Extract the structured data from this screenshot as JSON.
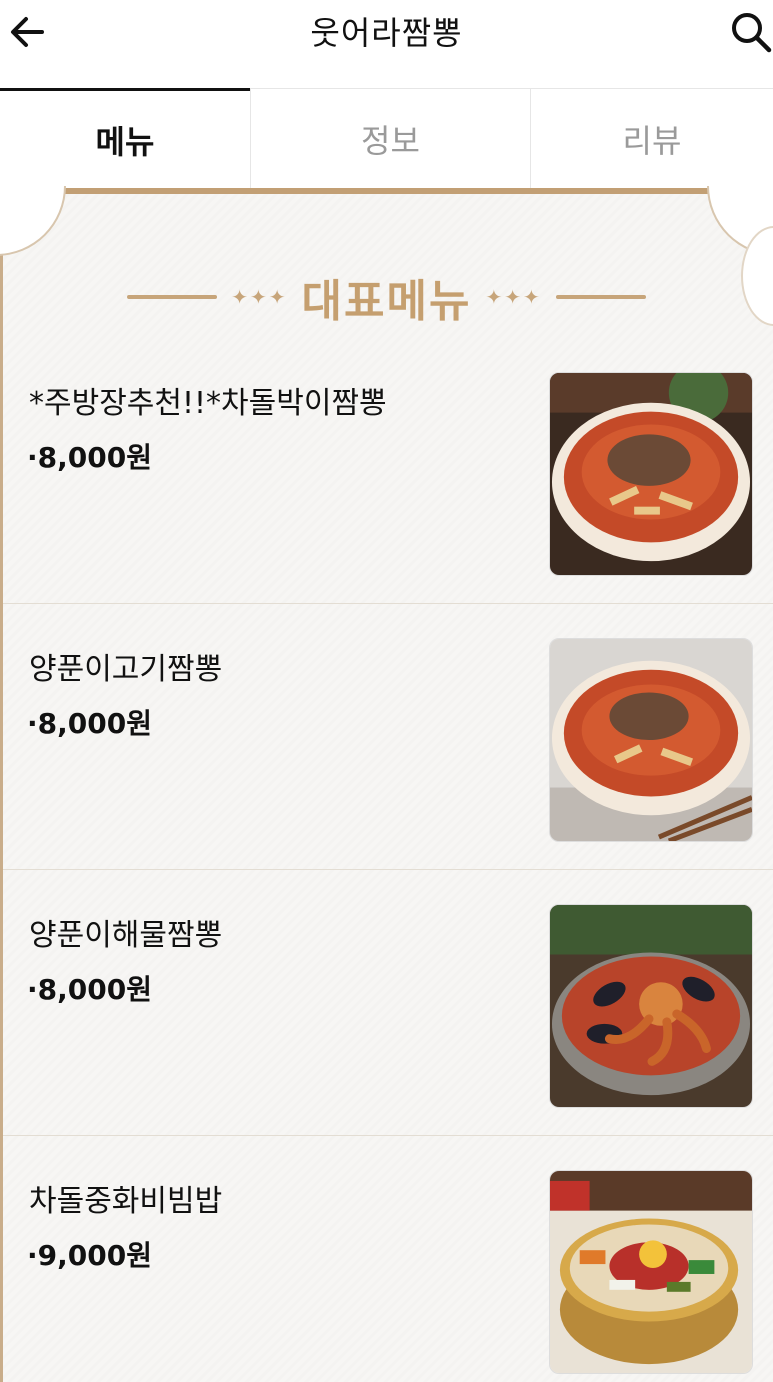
{
  "header": {
    "title": "웃어라짬뽕",
    "back_icon": "arrow-left-icon",
    "search_icon": "search-icon"
  },
  "tabs": [
    {
      "label": "메뉴",
      "active": true
    },
    {
      "label": "정보",
      "active": false
    },
    {
      "label": "리뷰",
      "active": false
    }
  ],
  "section": {
    "title": "대표메뉴",
    "stars": "✦✦✦"
  },
  "menu_items": [
    {
      "name": "*주방장추천!!*차돌박이짬뽕",
      "price": "·8,000원",
      "image": "beef-jjamppong-photo"
    },
    {
      "name": "양푼이고기짬뽕",
      "price": "·8,000원",
      "image": "meat-jjamppong-photo"
    },
    {
      "name": "양푼이해물짬뽕",
      "price": "·8,000원",
      "image": "seafood-jjamppong-photo"
    },
    {
      "name": "차돌중화비빔밥",
      "price": "·9,000원",
      "image": "bibimbap-photo"
    }
  ],
  "colors": {
    "accent_gold": "#c59f6f",
    "paper_bg": "#f7f6f4",
    "text": "#111111",
    "tab_inactive": "#9a9a9a"
  }
}
